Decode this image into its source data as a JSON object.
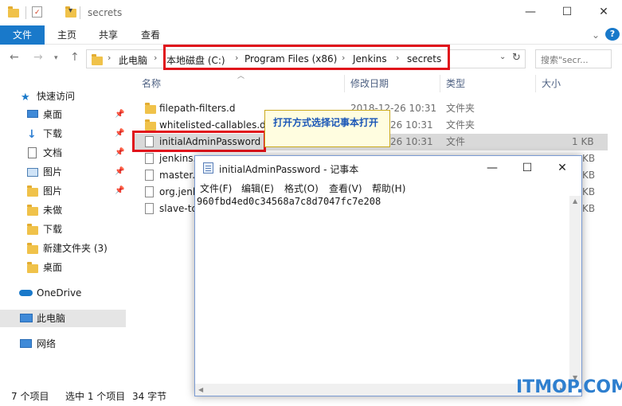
{
  "window": {
    "title": "secrets",
    "controls": {
      "minimize": "—",
      "maximize": "☐",
      "close": "✕"
    }
  },
  "ribbon": {
    "tabs": [
      "文件",
      "主页",
      "共享",
      "查看"
    ],
    "expand": "⌄",
    "help": "?"
  },
  "address": {
    "crumbs": [
      "此电脑",
      "本地磁盘 (C:)",
      "Program Files (x86)",
      "Jenkins",
      "secrets"
    ],
    "separator": "›",
    "search_placeholder": "搜索\"secr...",
    "search_icon": "🔍"
  },
  "sidebar": {
    "items": [
      {
        "label": "快速访问",
        "icon": "star-icon",
        "pinned": false
      },
      {
        "label": "桌面",
        "icon": "desktop-icon",
        "pinned": true
      },
      {
        "label": "下载",
        "icon": "download-icon",
        "pinned": true
      },
      {
        "label": "文档",
        "icon": "document-icon",
        "pinned": true
      },
      {
        "label": "图片",
        "icon": "picture-icon",
        "pinned": true
      },
      {
        "label": "图片",
        "icon": "folder-icon",
        "pinned": true
      },
      {
        "label": "未做",
        "icon": "folder-icon",
        "pinned": false
      },
      {
        "label": "下载",
        "icon": "folder-icon",
        "pinned": false
      },
      {
        "label": "新建文件夹 (3)",
        "icon": "folder-icon",
        "pinned": false
      },
      {
        "label": "桌面",
        "icon": "folder-icon",
        "pinned": false
      },
      {
        "label": "OneDrive",
        "icon": "cloud-icon",
        "pinned": false
      },
      {
        "label": "此电脑",
        "icon": "computer-icon",
        "pinned": false
      },
      {
        "label": "网络",
        "icon": "network-icon",
        "pinned": false
      }
    ],
    "pin_glyph": "📌"
  },
  "file_list": {
    "columns": [
      "名称",
      "修改日期",
      "类型",
      "大小"
    ],
    "rows": [
      {
        "name": "filepath-filters.d",
        "date": "2018-12-26 10:31",
        "type": "文件夹",
        "size": "",
        "kind": "folder"
      },
      {
        "name": "whitelisted-callables.d",
        "date": "26 10:31",
        "type": "文件夹",
        "size": "",
        "kind": "folder"
      },
      {
        "name": "initialAdminPassword",
        "date": "26 10:31",
        "type": "文件",
        "size": "1 KB",
        "kind": "file"
      },
      {
        "name": "jenkins.",
        "date": "",
        "type": "",
        "size": "KB",
        "kind": "file"
      },
      {
        "name": "master.",
        "date": "",
        "type": "",
        "size": "KB",
        "kind": "file"
      },
      {
        "name": "org.jenl",
        "date": "",
        "type": "",
        "size": "KB",
        "kind": "file"
      },
      {
        "name": "slave-to",
        "date": "",
        "type": "",
        "size": "KB",
        "kind": "file"
      }
    ]
  },
  "tooltip": {
    "text": "打开方式选择记事本打开"
  },
  "notepad": {
    "title": "initialAdminPassword - 记事本",
    "menu": [
      "文件(F)",
      "编辑(E)",
      "格式(O)",
      "查看(V)",
      "帮助(H)"
    ],
    "content": "960fbd4ed0c34568a7c8d7047fc7e208",
    "controls": {
      "minimize": "—",
      "maximize": "☐",
      "close": "✕"
    }
  },
  "status": {
    "count": "7 个项目",
    "selected": "选中 1 个项目",
    "size": "34 字节"
  },
  "watermark": {
    "text": "ITMOP.COM"
  },
  "colors": {
    "accent": "#1979ca",
    "highlight": "#e0131b",
    "folder": "#f0c24a",
    "tooltip_bg": "#fffde0",
    "tooltip_text": "#1a56b7"
  }
}
